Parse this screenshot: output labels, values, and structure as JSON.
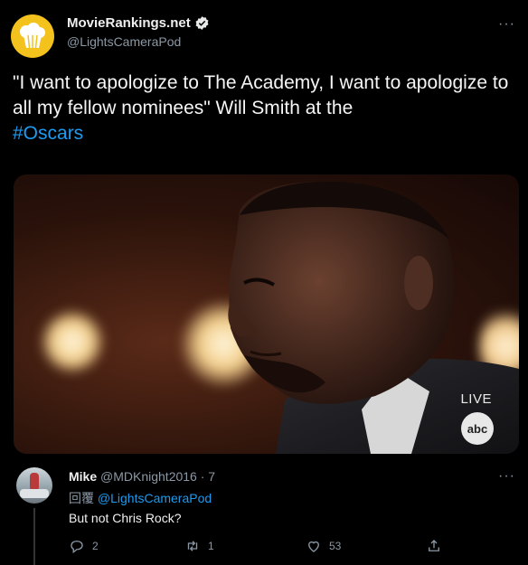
{
  "tweet": {
    "author_name": "MovieRankings.net",
    "author_handle": "@LightsCameraPod",
    "text_main": "\"I want to apologize to The Academy, I want to apologize to all my fellow nominees\" Will Smith at the",
    "hashtag": "#Oscars",
    "more_icon": "ellipsis-icon",
    "verified_icon": "verified-badge-icon"
  },
  "media": {
    "overlay_live": "LIVE",
    "overlay_logo": "abc"
  },
  "reply": {
    "name": "Mike",
    "handle_time": "@MDKnight2016 · 7",
    "reply_prefix": "回覆",
    "reply_mention": "@LightsCameraPod",
    "text": "But not Chris Rock?",
    "actions": {
      "reply_count": "2",
      "retweet_count": "1",
      "like_count": "53"
    }
  },
  "colors": {
    "background": "#000000",
    "link": "#1d9bf0",
    "muted": "#8b98a5",
    "avatar_yellow": "#f4c21c"
  }
}
